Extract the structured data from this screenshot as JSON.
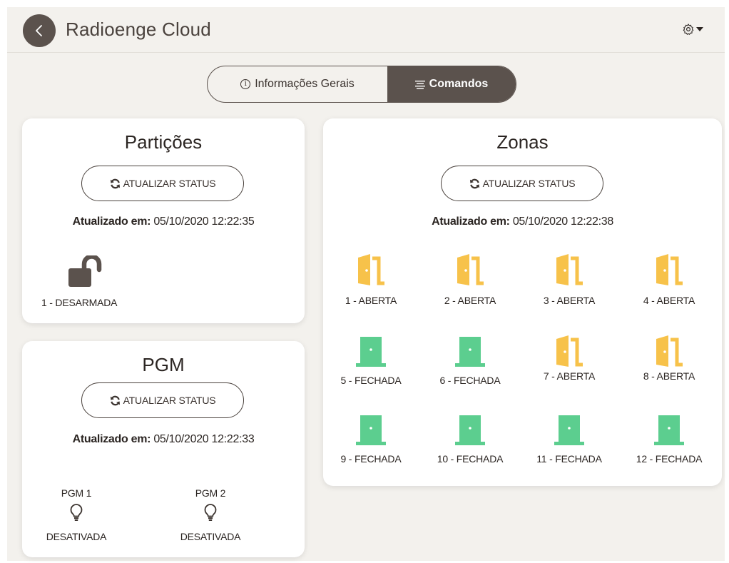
{
  "header": {
    "title": "Radioenge Cloud",
    "back_icon": "chevron-left-icon",
    "settings_icon": "gear-icon"
  },
  "tabs": [
    {
      "label": "Informações Gerais",
      "icon": "info-icon",
      "active": false
    },
    {
      "label": "Comandos",
      "icon": "list-icon",
      "active": true
    }
  ],
  "colors": {
    "accent": "#5b524d",
    "open": "#f7c24a",
    "closed": "#5cce8f",
    "background": "#f3f1ed"
  },
  "particoes": {
    "title": "Partições",
    "refresh_label": "ATUALIZAR STATUS",
    "updated_label": "Atualizado em:",
    "updated_value": "05/10/2020 12:22:35",
    "items": [
      {
        "label": "1 - DESARMADA",
        "icon": "unlocked-padlock-icon"
      }
    ]
  },
  "pgm": {
    "title": "PGM",
    "refresh_label": "ATUALIZAR STATUS",
    "updated_label": "Atualizado em:",
    "updated_value": "05/10/2020 12:22:33",
    "items": [
      {
        "name": "PGM 1",
        "status": "DESATIVADA",
        "icon": "lightbulb-icon"
      },
      {
        "name": "PGM 2",
        "status": "DESATIVADA",
        "icon": "lightbulb-icon"
      }
    ]
  },
  "zonas": {
    "title": "Zonas",
    "refresh_label": "ATUALIZAR STATUS",
    "updated_label": "Atualizado em:",
    "updated_value": "05/10/2020 12:22:38",
    "items": [
      {
        "label": "1 - ABERTA",
        "state": "open"
      },
      {
        "label": "2 - ABERTA",
        "state": "open"
      },
      {
        "label": "3 - ABERTA",
        "state": "open"
      },
      {
        "label": "4 - ABERTA",
        "state": "open"
      },
      {
        "label": "5 - FECHADA",
        "state": "closed"
      },
      {
        "label": "6 - FECHADA",
        "state": "closed"
      },
      {
        "label": "7 - ABERTA",
        "state": "open"
      },
      {
        "label": "8 - ABERTA",
        "state": "open"
      },
      {
        "label": "9 - FECHADA",
        "state": "closed"
      },
      {
        "label": "10 - FECHADA",
        "state": "closed"
      },
      {
        "label": "11 - FECHADA",
        "state": "closed"
      },
      {
        "label": "12 - FECHADA",
        "state": "closed"
      }
    ]
  }
}
